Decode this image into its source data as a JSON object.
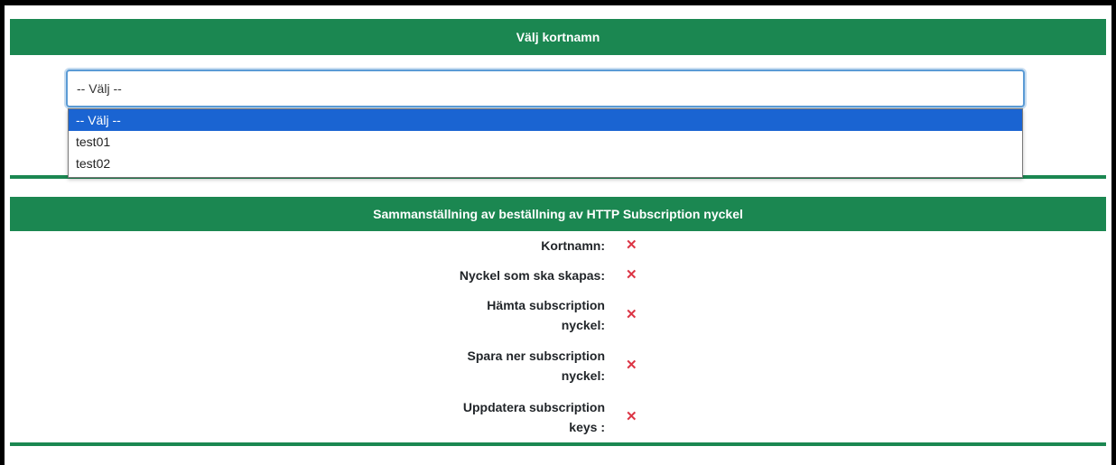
{
  "section1": {
    "title": "Välj kortnamn",
    "select": {
      "value": "-- Välj --",
      "options": [
        "-- Välj --",
        "test01",
        "test02"
      ],
      "highlighted_index": 0
    }
  },
  "section2": {
    "title": "Sammanställning av beställning av HTTP Subscription nyckel",
    "rows": [
      {
        "label": "Kortnamn:",
        "status": "✕"
      },
      {
        "label": "Nyckel som ska skapas:",
        "status": "✕"
      },
      {
        "label": "Hämta subscription nyckel:",
        "status": "✕"
      },
      {
        "label": "Spara ner subscription nyckel:",
        "status": "✕"
      },
      {
        "label": "Uppdatera subscription keys :",
        "status": "✕"
      }
    ]
  },
  "colors": {
    "header_green": "#1b8751",
    "selected_blue": "#1a64d2",
    "status_red": "#dc3545"
  }
}
